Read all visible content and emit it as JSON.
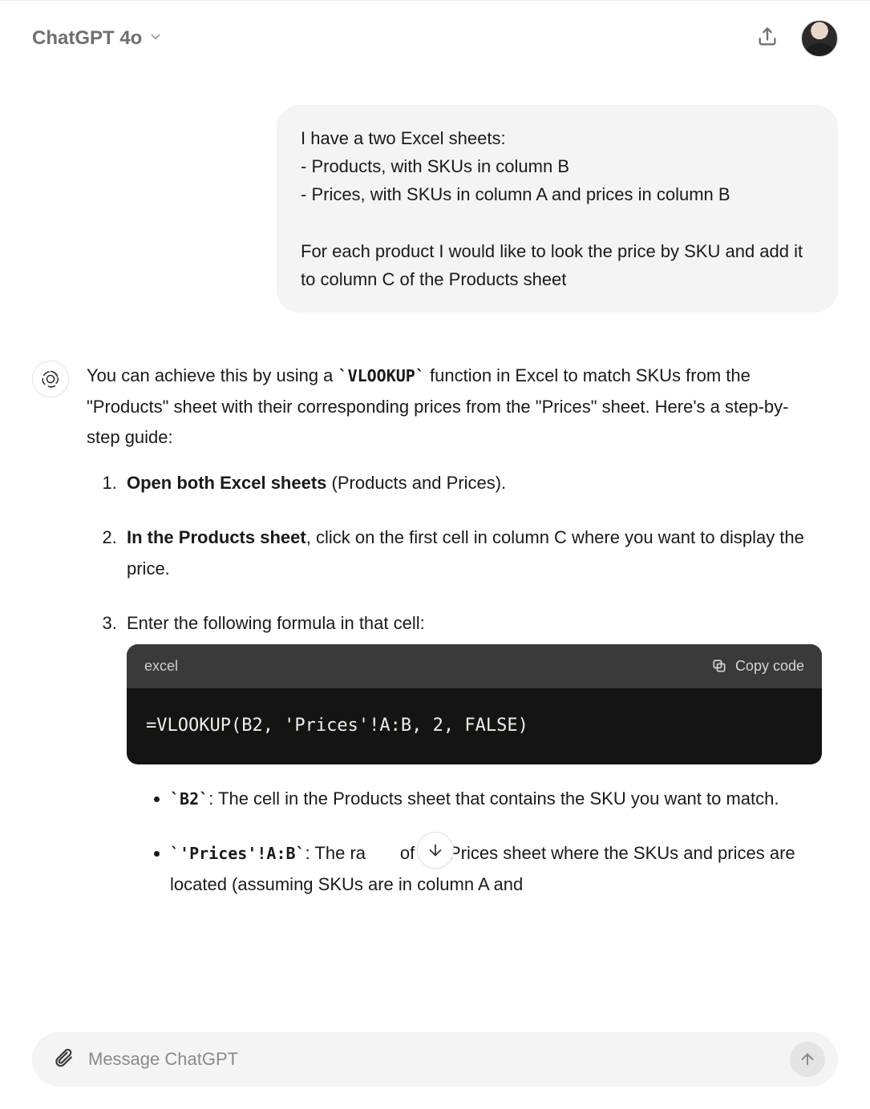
{
  "header": {
    "model_label": "ChatGPT 4o"
  },
  "user_message": "I have a two Excel sheets:\n- Products, with SKUs in column B\n- Prices, with SKUs in column A and prices in column B\n\nFor each product I would like to look the price by SKU and add it to column C of the Products sheet",
  "assistant": {
    "intro_pre": "You can achieve this by using a ",
    "intro_code": "VLOOKUP",
    "intro_post": " function in Excel to match SKUs from the \"Products\" sheet with their corresponding prices from the \"Prices\" sheet. Here's a step-by-step guide:",
    "step1_bold": "Open both Excel sheets",
    "step1_rest": " (Products and Prices).",
    "step2_bold": "In the Products sheet",
    "step2_rest": ", click on the first cell in column C where you want to display the price.",
    "step3": "Enter the following formula in that cell:",
    "code_lang": "excel",
    "copy_label": "Copy code",
    "code_content": "=VLOOKUP(B2, 'Prices'!A:B, 2, FALSE)",
    "bullet1_code": "B2",
    "bullet1_text": ": The cell in the Products sheet that contains the SKU you want to match.",
    "bullet2_code": "'Prices'!A:B",
    "bullet2_pre": ": The ra",
    "bullet2_post": " of the Prices sheet where the SKUs and prices are located (assuming SKUs are in column A and"
  },
  "composer": {
    "placeholder": "Message ChatGPT"
  }
}
